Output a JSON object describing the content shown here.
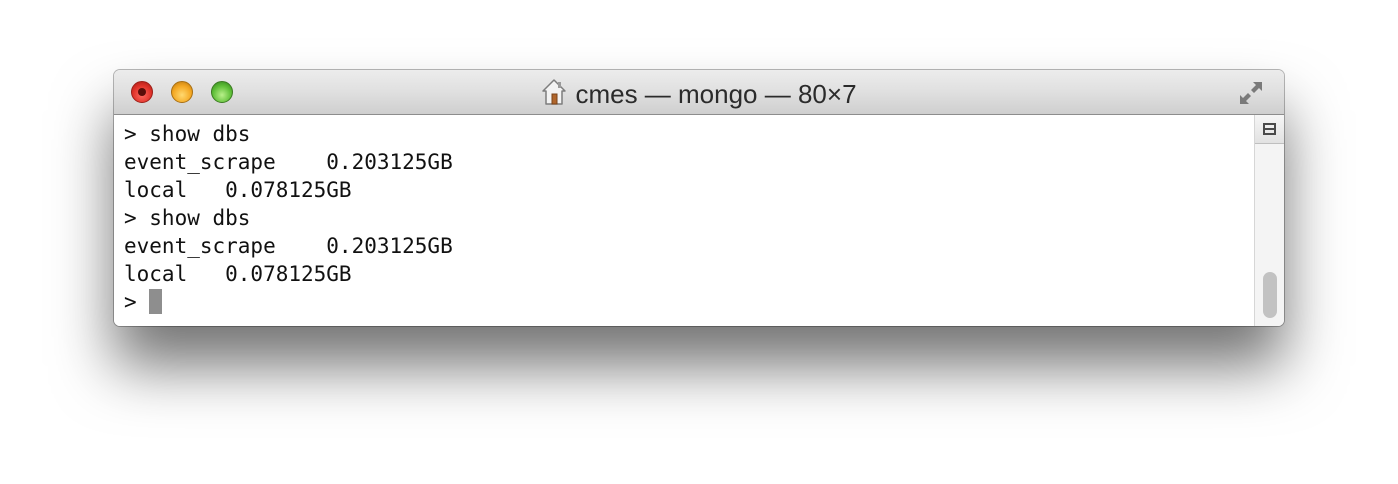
{
  "window": {
    "title": "cmes — mongo — 80×7",
    "title_icon": "home-icon"
  },
  "traffic_lights": {
    "close": "#e0332a",
    "minimize": "#f4a823",
    "zoom": "#5fbf38"
  },
  "terminal": {
    "lines": [
      "> show dbs",
      "event_scrape    0.203125GB",
      "local   0.078125GB",
      "> show dbs",
      "event_scrape    0.203125GB",
      "local   0.078125GB"
    ],
    "prompt": "> "
  },
  "scrollbar": {
    "split_icon": "split-pane-icon"
  }
}
